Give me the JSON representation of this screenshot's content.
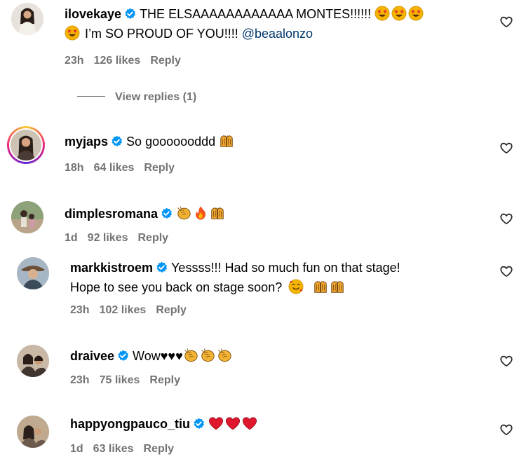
{
  "comments": [
    {
      "username": "ilovekaye",
      "text_a": "THE ELSAAAAAAAAAAAA MONTES!!!!!!",
      "text_b": "I’m SO PROUD OF YOU!!!! ",
      "mention": "@beaalonzo",
      "time": "23h",
      "likes": "126 likes",
      "reply": "Reply"
    },
    {
      "username": "myjaps",
      "text": "So gooooooddd",
      "time": "18h",
      "likes": "64 likes",
      "reply": "Reply"
    },
    {
      "username": "dimplesromana",
      "text": "",
      "time": "1d",
      "likes": "92 likes",
      "reply": "Reply"
    },
    {
      "username": "markkistroem",
      "text_a": "Yessss!!! Had so much fun on that stage!",
      "text_b": "Hope to see you back on stage soon?",
      "time": "23h",
      "likes": "102 likes",
      "reply": "Reply"
    },
    {
      "username": "draivee",
      "text": "Wow♥♥♥",
      "time": "23h",
      "likes": "75 likes",
      "reply": "Reply"
    },
    {
      "username": "happyongpauco_tiu",
      "text": "",
      "time": "1d",
      "likes": "63 likes",
      "reply": "Reply"
    }
  ],
  "view_replies": "View replies (1)",
  "icons": {
    "verified": "verified-badge-icon",
    "heart": "heart-outline-icon",
    "emojis": [
      "star-struck-emoji",
      "open-hands-emoji",
      "clapping-hands-emoji",
      "fire-emoji",
      "smiling-hearts-emoji",
      "red-heart-emoji"
    ]
  },
  "colors": {
    "verified": "#0095f6",
    "meta": "#737373",
    "mention": "#00376b"
  }
}
